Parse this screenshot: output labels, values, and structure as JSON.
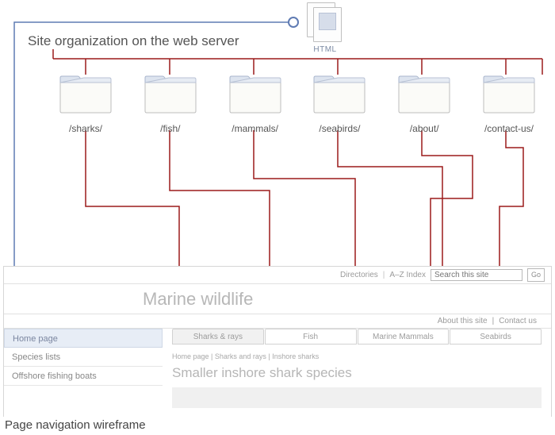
{
  "title": "Site organization on the web server",
  "caption": "Page navigation wireframe",
  "doc": {
    "label": "HTML"
  },
  "folders": [
    {
      "path": "/sharks/"
    },
    {
      "path": "/fish/"
    },
    {
      "path": "/mammals/"
    },
    {
      "path": "/seabirds/"
    },
    {
      "path": "/about/"
    },
    {
      "path": "/contact-us/"
    }
  ],
  "wireframe": {
    "topbar": {
      "directories": "Directories",
      "az_index": "A–Z Index",
      "search_placeholder": "Search this site",
      "go_label": "Go"
    },
    "brand": "Marine wildlife",
    "utility": {
      "about": "About this site",
      "contact": "Contact us"
    },
    "tabs": [
      {
        "label": "Sharks & rays",
        "active": true
      },
      {
        "label": "Fish",
        "active": false
      },
      {
        "label": "Marine Mammals",
        "active": false
      },
      {
        "label": "Seabirds",
        "active": false
      }
    ],
    "sidebar": [
      {
        "label": "Home page",
        "current": true
      },
      {
        "label": "Species lists",
        "current": false
      },
      {
        "label": "Offshore fishing boats",
        "current": false
      }
    ],
    "breadcrumbs": "Home page   |   Sharks and rays   |   Inshore sharks",
    "heading": "Smaller inshore shark species"
  }
}
